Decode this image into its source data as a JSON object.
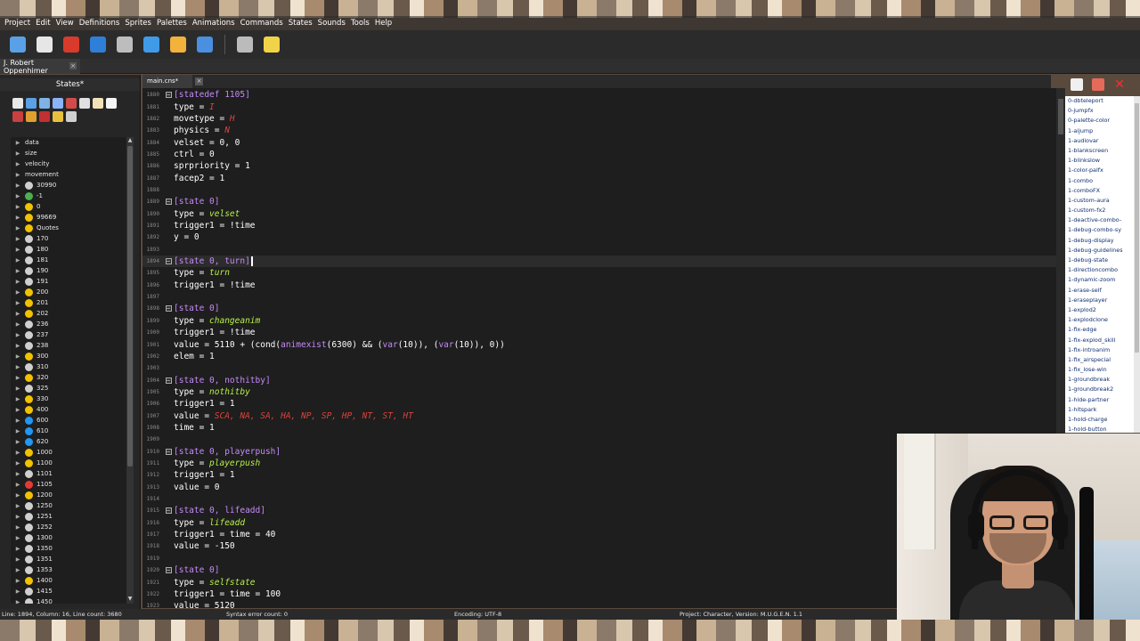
{
  "menu": [
    "Project",
    "Edit",
    "View",
    "Definitions",
    "Sprites",
    "Palettes",
    "Animations",
    "Commands",
    "States",
    "Sounds",
    "Tools",
    "Help"
  ],
  "toolbar_icons": [
    "project-icon",
    "open-icon",
    "film-icon",
    "window-icon",
    "import-icon",
    "compile-icon",
    "palette-icon",
    "puzzle-icon",
    "settings-tools-icon",
    "character-icon"
  ],
  "project_tab": {
    "label": "J. Robert Oppenhimer",
    "close": "×"
  },
  "left_panel": {
    "title": "States*",
    "tree": [
      {
        "label": "data",
        "kind": "folder"
      },
      {
        "label": "size",
        "kind": "folder"
      },
      {
        "label": "velocity",
        "kind": "folder"
      },
      {
        "label": "movement",
        "kind": "folder"
      },
      {
        "label": "30990",
        "kind": "state",
        "color": "#cfcfcf"
      },
      {
        "label": "-1",
        "kind": "state",
        "color": "#4caf50"
      },
      {
        "label": "0",
        "kind": "state",
        "color": "#f2c200"
      },
      {
        "label": "99669",
        "kind": "state",
        "color": "#f2c200"
      },
      {
        "label": "Quotes",
        "kind": "state",
        "color": "#f2c200"
      },
      {
        "label": "170",
        "kind": "state",
        "color": "#cfcfcf"
      },
      {
        "label": "180",
        "kind": "state",
        "color": "#cfcfcf"
      },
      {
        "label": "181",
        "kind": "state",
        "color": "#cfcfcf"
      },
      {
        "label": "190",
        "kind": "state",
        "color": "#cfcfcf"
      },
      {
        "label": "191",
        "kind": "state",
        "color": "#cfcfcf"
      },
      {
        "label": "200",
        "kind": "state",
        "color": "#f2c200"
      },
      {
        "label": "201",
        "kind": "state",
        "color": "#f2c200"
      },
      {
        "label": "202",
        "kind": "state",
        "color": "#f2c200"
      },
      {
        "label": "236",
        "kind": "state",
        "color": "#cfcfcf"
      },
      {
        "label": "237",
        "kind": "state",
        "color": "#cfcfcf"
      },
      {
        "label": "238",
        "kind": "state",
        "color": "#cfcfcf"
      },
      {
        "label": "300",
        "kind": "state",
        "color": "#f2c200"
      },
      {
        "label": "310",
        "kind": "state",
        "color": "#cfcfcf"
      },
      {
        "label": "320",
        "kind": "state",
        "color": "#f2c200"
      },
      {
        "label": "325",
        "kind": "state",
        "color": "#cfcfcf"
      },
      {
        "label": "330",
        "kind": "state",
        "color": "#f2c200"
      },
      {
        "label": "400",
        "kind": "state",
        "color": "#f2c200"
      },
      {
        "label": "600",
        "kind": "state",
        "color": "#2196f3"
      },
      {
        "label": "610",
        "kind": "state",
        "color": "#2196f3"
      },
      {
        "label": "620",
        "kind": "state",
        "color": "#2196f3"
      },
      {
        "label": "1000",
        "kind": "state",
        "color": "#f2c200"
      },
      {
        "label": "1100",
        "kind": "state",
        "color": "#f2c200"
      },
      {
        "label": "1101",
        "kind": "state",
        "color": "#cfcfcf"
      },
      {
        "label": "1105",
        "kind": "state",
        "color": "#e53935"
      },
      {
        "label": "1200",
        "kind": "state",
        "color": "#f2c200"
      },
      {
        "label": "1250",
        "kind": "state",
        "color": "#cfcfcf"
      },
      {
        "label": "1251",
        "kind": "state",
        "color": "#cfcfcf"
      },
      {
        "label": "1252",
        "kind": "state",
        "color": "#cfcfcf"
      },
      {
        "label": "1300",
        "kind": "state",
        "color": "#cfcfcf"
      },
      {
        "label": "1350",
        "kind": "state",
        "color": "#cfcfcf"
      },
      {
        "label": "1351",
        "kind": "state",
        "color": "#cfcfcf"
      },
      {
        "label": "1353",
        "kind": "state",
        "color": "#cfcfcf"
      },
      {
        "label": "1400",
        "kind": "state",
        "color": "#f2c200"
      },
      {
        "label": "1415",
        "kind": "state",
        "color": "#cfcfcf"
      },
      {
        "label": "1450",
        "kind": "state",
        "color": "#cfcfcf"
      }
    ]
  },
  "document_tab": {
    "label": "main.cns*",
    "close": "×"
  },
  "editor": {
    "current_line": 1894,
    "lines": [
      {
        "n": "1880",
        "fold": true,
        "parts": [
          [
            "sec",
            "[statedef 1105]"
          ]
        ]
      },
      {
        "n": "1881",
        "fold": false,
        "parts": [
          [
            "key",
            "type = "
          ],
          [
            "valr",
            "I"
          ]
        ]
      },
      {
        "n": "1882",
        "fold": false,
        "parts": [
          [
            "key",
            "movetype = "
          ],
          [
            "valr",
            "H"
          ]
        ]
      },
      {
        "n": "1883",
        "fold": false,
        "parts": [
          [
            "key",
            "physics = "
          ],
          [
            "valr",
            "N"
          ]
        ]
      },
      {
        "n": "1884",
        "fold": false,
        "parts": [
          [
            "key",
            "velset = 0, 0"
          ]
        ]
      },
      {
        "n": "1885",
        "fold": false,
        "parts": [
          [
            "key",
            "ctrl = 0"
          ]
        ]
      },
      {
        "n": "1886",
        "fold": false,
        "parts": [
          [
            "key",
            "sprpriority = 1"
          ]
        ]
      },
      {
        "n": "1887",
        "fold": false,
        "parts": [
          [
            "key",
            "facep2 = 1"
          ]
        ]
      },
      {
        "n": "1888",
        "fold": false,
        "parts": []
      },
      {
        "n": "1889",
        "fold": true,
        "parts": [
          [
            "sec",
            "[state 0]"
          ]
        ]
      },
      {
        "n": "1890",
        "fold": false,
        "parts": [
          [
            "key",
            "type = "
          ],
          [
            "valg",
            "velset"
          ]
        ]
      },
      {
        "n": "1891",
        "fold": false,
        "parts": [
          [
            "key",
            "trigger1 = !time"
          ]
        ]
      },
      {
        "n": "1892",
        "fold": false,
        "parts": [
          [
            "key",
            "y = 0"
          ]
        ]
      },
      {
        "n": "1893",
        "fold": false,
        "parts": []
      },
      {
        "n": "1894",
        "fold": true,
        "parts": [
          [
            "sec",
            "[state 0, turn]"
          ]
        ]
      },
      {
        "n": "1895",
        "fold": false,
        "parts": [
          [
            "key",
            "type = "
          ],
          [
            "valg",
            "turn"
          ]
        ]
      },
      {
        "n": "1896",
        "fold": false,
        "parts": [
          [
            "key",
            "trigger1 = !time"
          ]
        ]
      },
      {
        "n": "1897",
        "fold": false,
        "parts": []
      },
      {
        "n": "1898",
        "fold": true,
        "parts": [
          [
            "sec",
            "[state 0]"
          ]
        ]
      },
      {
        "n": "1899",
        "fold": false,
        "parts": [
          [
            "key",
            "type = "
          ],
          [
            "valg",
            "changeanim"
          ]
        ]
      },
      {
        "n": "1900",
        "fold": false,
        "parts": [
          [
            "key",
            "trigger1 = !time"
          ]
        ]
      },
      {
        "n": "1901",
        "fold": false,
        "parts": [
          [
            "key",
            "value = 5110 + (cond("
          ],
          [
            "fn",
            "animexist"
          ],
          [
            "key",
            "(6300) && ("
          ],
          [
            "fn",
            "var"
          ],
          [
            "key",
            "(10)), ("
          ],
          [
            "fn",
            "var"
          ],
          [
            "key",
            "(10)), 0))"
          ]
        ]
      },
      {
        "n": "1902",
        "fold": false,
        "parts": [
          [
            "key",
            "elem = 1"
          ]
        ]
      },
      {
        "n": "1903",
        "fold": false,
        "parts": []
      },
      {
        "n": "1904",
        "fold": true,
        "parts": [
          [
            "sec",
            "[state 0, nothitby]"
          ]
        ]
      },
      {
        "n": "1905",
        "fold": false,
        "parts": [
          [
            "key",
            "type = "
          ],
          [
            "valg",
            "nothitby"
          ]
        ]
      },
      {
        "n": "1906",
        "fold": false,
        "parts": [
          [
            "key",
            "trigger1 = 1"
          ]
        ]
      },
      {
        "n": "1907",
        "fold": false,
        "parts": [
          [
            "key",
            "value = "
          ],
          [
            "valr",
            "SCA, NA, SA, HA, NP, SP, HP, NT, ST, HT"
          ]
        ]
      },
      {
        "n": "1908",
        "fold": false,
        "parts": [
          [
            "key",
            "time = 1"
          ]
        ]
      },
      {
        "n": "1909",
        "fold": false,
        "parts": []
      },
      {
        "n": "1910",
        "fold": true,
        "parts": [
          [
            "sec",
            "[state 0, playerpush]"
          ]
        ]
      },
      {
        "n": "1911",
        "fold": false,
        "parts": [
          [
            "key",
            "type = "
          ],
          [
            "valg",
            "playerpush"
          ]
        ]
      },
      {
        "n": "1912",
        "fold": false,
        "parts": [
          [
            "key",
            "trigger1 = 1"
          ]
        ]
      },
      {
        "n": "1913",
        "fold": false,
        "parts": [
          [
            "key",
            "value = 0"
          ]
        ]
      },
      {
        "n": "1914",
        "fold": false,
        "parts": []
      },
      {
        "n": "1915",
        "fold": true,
        "parts": [
          [
            "sec",
            "[state 0, lifeadd]"
          ]
        ]
      },
      {
        "n": "1916",
        "fold": false,
        "parts": [
          [
            "key",
            "type = "
          ],
          [
            "valg",
            "lifeadd"
          ]
        ]
      },
      {
        "n": "1917",
        "fold": false,
        "parts": [
          [
            "key",
            "trigger1 = time = 40"
          ]
        ]
      },
      {
        "n": "1918",
        "fold": false,
        "parts": [
          [
            "key",
            "value = -150"
          ]
        ]
      },
      {
        "n": "1919",
        "fold": false,
        "parts": []
      },
      {
        "n": "1920",
        "fold": true,
        "parts": [
          [
            "sec",
            "[state 0]"
          ]
        ]
      },
      {
        "n": "1921",
        "fold": false,
        "parts": [
          [
            "key",
            "type = "
          ],
          [
            "valg",
            "selfstate"
          ]
        ]
      },
      {
        "n": "1922",
        "fold": false,
        "parts": [
          [
            "key",
            "trigger1 = time = 100"
          ]
        ]
      },
      {
        "n": "1923",
        "fold": false,
        "parts": [
          [
            "key",
            "value = 5120"
          ]
        ]
      }
    ]
  },
  "snippets": [
    "0-dbteleport",
    "0-jumpfx",
    "0-palette-color",
    "1-aijump",
    "1-audiovar",
    "1-blankscreen",
    "1-blinkslow",
    "1-color-palfx",
    "1-combo",
    "1-comboFX",
    "1-custom-aura",
    "1-custom-fx2",
    "1-deactive-combo-",
    "1-debug-combo-sy",
    "1-debug-display",
    "1-debug-guidelines",
    "1-debug-state",
    "1-directioncombo",
    "1-dynamic-zoom",
    "1-erase-self",
    "1-eraseplayer",
    "1-explod2",
    "1-explodclone",
    "1-fix-edge",
    "1-fix-explod_skill",
    "1-fix-introanim",
    "1-fix_airspecial",
    "1-fix_lose-win",
    "1-groundbreak",
    "1-groundbreak2",
    "1-hide-partner",
    "1-hitspark",
    "1-hold-charge",
    "1-hold-button"
  ],
  "status": {
    "position": "Line: 1894, Column: 16, Line count: 3680",
    "syntax": "Syntax error count: 0",
    "encoding": "Encoding: UTF-8",
    "project": "Project: Character, Version: M.U.G.E.N. 1.1"
  }
}
